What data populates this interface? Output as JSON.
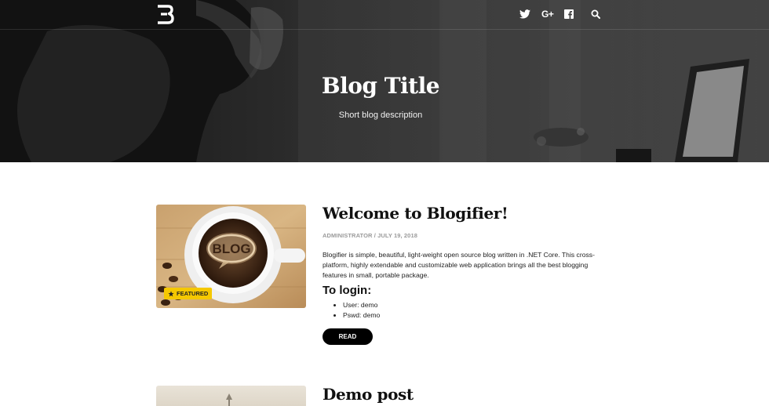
{
  "header": {
    "logo_icon": "blogifier-b-logo",
    "social": [
      {
        "name": "twitter",
        "icon": "twitter-icon"
      },
      {
        "name": "google-plus",
        "icon": "google-plus-icon",
        "label": "G+"
      },
      {
        "name": "facebook",
        "icon": "facebook-icon"
      }
    ],
    "search_icon": "search-icon"
  },
  "hero": {
    "title": "Blog Title",
    "description": "Short blog description"
  },
  "posts": [
    {
      "title": "Welcome to Blogifier!",
      "meta": "ADMINISTRATOR / JULY 19, 2018",
      "badge": "FEATURED",
      "thumb_text": "BLOG",
      "excerpt": "Blogifier is simple, beautiful, light-weight open source blog written in .NET Core. This cross-platform, highly extendable and customizable web application brings all the best blogging features in small, portable package.",
      "subheading": "To login:",
      "list": [
        "User: demo",
        "Pswd: demo"
      ],
      "button": "READ"
    },
    {
      "title": "Demo post"
    }
  ],
  "colors": {
    "badge": "#f5c800",
    "button": "#000000",
    "meta": "#9a9a9a"
  }
}
